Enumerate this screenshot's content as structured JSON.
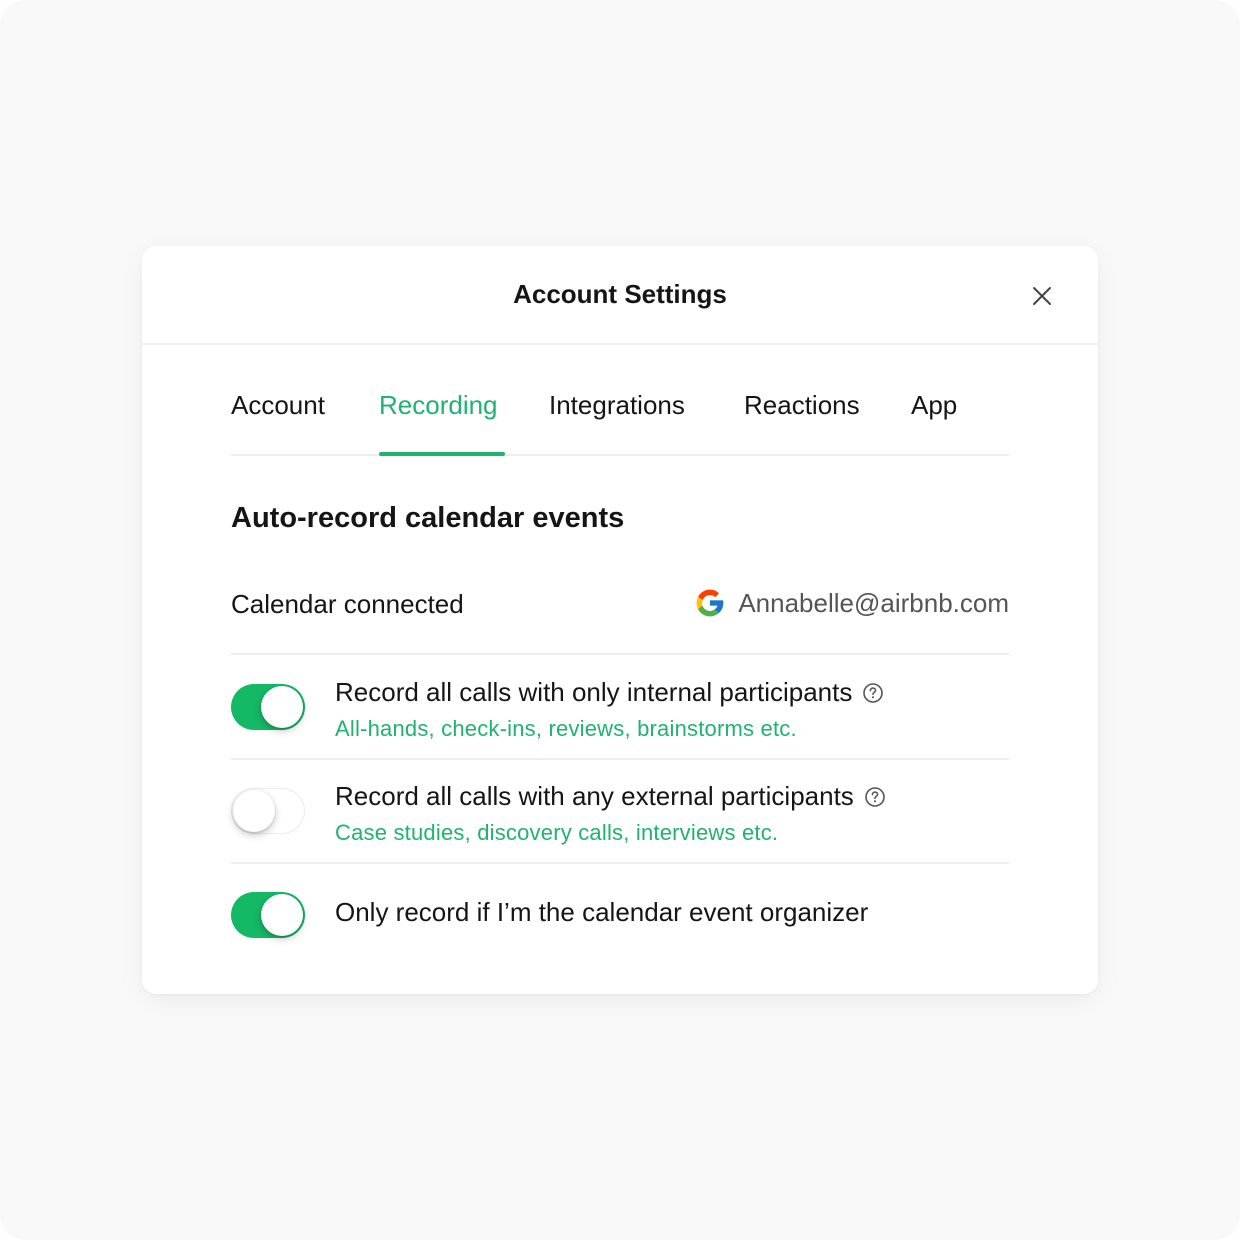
{
  "modal": {
    "title": "Account Settings"
  },
  "tabs": [
    {
      "label": "Account",
      "active": false
    },
    {
      "label": "Recording",
      "active": true
    },
    {
      "label": "Integrations",
      "active": false
    },
    {
      "label": "Reactions",
      "active": false
    },
    {
      "label": "App",
      "active": false
    }
  ],
  "section": {
    "title": "Auto-record calendar events"
  },
  "calendar": {
    "label": "Calendar connected",
    "provider_icon": "google-icon",
    "account": "Annabelle@airbnb.com"
  },
  "settings": [
    {
      "label": "Record all calls with only internal participants",
      "sublabel": "All-hands, check-ins, reviews, brainstorms etc.",
      "enabled": true,
      "help_icon": "question-circle-icon"
    },
    {
      "label": "Record all calls with any external participants",
      "sublabel": "Case studies, discovery calls, interviews etc.",
      "enabled": false,
      "help_icon": "question-circle-icon"
    },
    {
      "label": "Only record if I’m the calendar event organizer",
      "enabled": true
    }
  ],
  "colors": {
    "accent": "#1fb370",
    "toggle_on": "#14b965",
    "text": "#151515",
    "muted_text": "#555555",
    "divider": "#eeeeee",
    "background": "#f9f9f9"
  }
}
